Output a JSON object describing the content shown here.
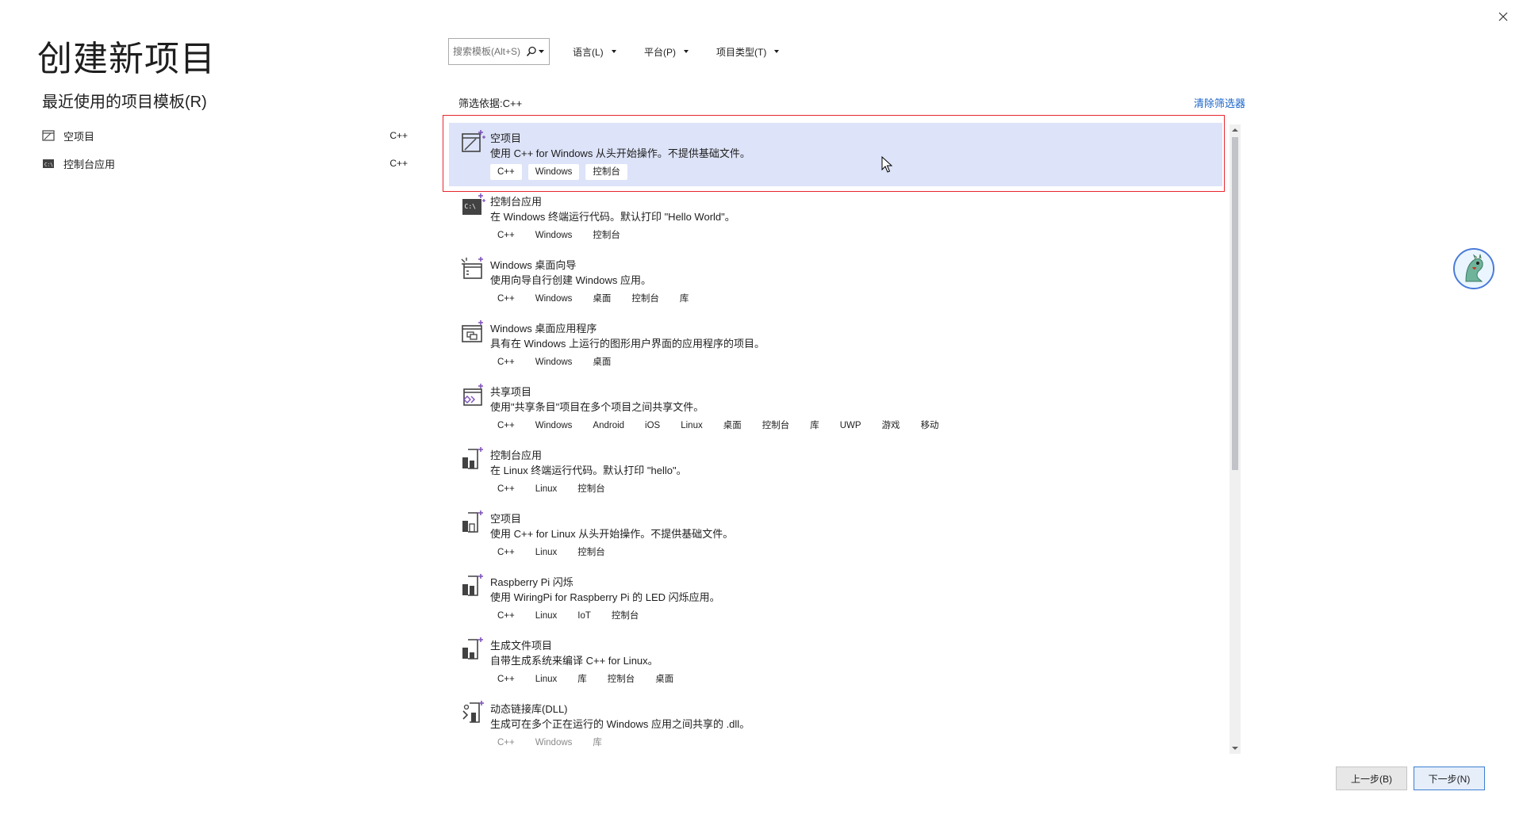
{
  "window": {
    "close_label": "×"
  },
  "page_title": "创建新项目",
  "recent": {
    "title": "最近使用的项目模板(R)",
    "items": [
      {
        "label": "空项目",
        "lang": "C++",
        "icon": "empty-project-icon"
      },
      {
        "label": "控制台应用",
        "lang": "C++",
        "icon": "console-app-icon"
      }
    ]
  },
  "search": {
    "placeholder": "搜索模板(Alt+S)",
    "value": ""
  },
  "filters": {
    "language": "语言(L)",
    "platform": "平台(P)",
    "project_type": "项目类型(T)"
  },
  "filter_by": "筛选依据:C++",
  "clear_filter": "清除筛选器",
  "templates": [
    {
      "name": "空项目",
      "desc": "使用 C++ for Windows 从头开始操作。不提供基础文件。",
      "tags": [
        "C++",
        "Windows",
        "控制台"
      ],
      "icon": "empty-project-icon",
      "selected": true
    },
    {
      "name": "控制台应用",
      "desc": "在 Windows 终端运行代码。默认打印 \"Hello World\"。",
      "tags": [
        "C++",
        "Windows",
        "控制台"
      ],
      "icon": "console-app-icon"
    },
    {
      "name": "Windows 桌面向导",
      "desc": "使用向导自行创建 Windows 应用。",
      "tags": [
        "C++",
        "Windows",
        "桌面",
        "控制台",
        "库"
      ],
      "icon": "desktop-wizard-icon"
    },
    {
      "name": "Windows 桌面应用程序",
      "desc": "具有在 Windows 上运行的图形用户界面的应用程序的项目。",
      "tags": [
        "C++",
        "Windows",
        "桌面"
      ],
      "icon": "desktop-app-icon"
    },
    {
      "name": "共享项目",
      "desc": "使用\"共享条目\"项目在多个项目之间共享文件。",
      "tags": [
        "C++",
        "Windows",
        "Android",
        "iOS",
        "Linux",
        "桌面",
        "控制台",
        "库",
        "UWP",
        "游戏",
        "移动"
      ],
      "icon": "shared-project-icon"
    },
    {
      "name": "控制台应用",
      "desc": "在 Linux 终端运行代码。默认打印 \"hello\"。",
      "tags": [
        "C++",
        "Linux",
        "控制台"
      ],
      "icon": "linux-console-icon"
    },
    {
      "name": "空项目",
      "desc": "使用 C++ for Linux 从头开始操作。不提供基础文件。",
      "tags": [
        "C++",
        "Linux",
        "控制台"
      ],
      "icon": "linux-empty-icon"
    },
    {
      "name": "Raspberry Pi 闪烁",
      "desc": "使用 WiringPi for Raspberry Pi 的 LED 闪烁应用。",
      "tags": [
        "C++",
        "Linux",
        "IoT",
        "控制台"
      ],
      "icon": "raspberry-pi-icon"
    },
    {
      "name": "生成文件项目",
      "desc": "自带生成系统来编译 C++ for Linux。",
      "tags": [
        "C++",
        "Linux",
        "库",
        "控制台",
        "桌面"
      ],
      "icon": "makefile-project-icon"
    },
    {
      "name": "动态链接库(DLL)",
      "desc": "生成可在多个正在运行的 Windows 应用之间共享的 .dll。",
      "tags": [
        "C++",
        "Windows",
        "库"
      ],
      "icon": "dll-icon",
      "faded": true
    }
  ],
  "buttons": {
    "back": "上一步(B)",
    "next": "下一步(N)"
  },
  "colors": {
    "selected_bg": "#dde3f8",
    "selection_outline": "#e8262d",
    "link": "#1a64c8",
    "icon_accent": "#7b4fb8"
  }
}
